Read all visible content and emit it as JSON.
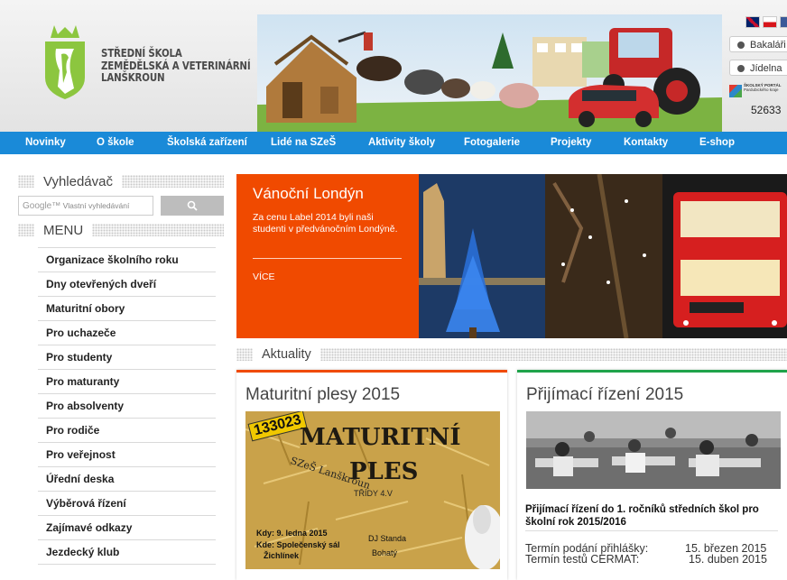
{
  "header": {
    "school_name_line1": "STŘEDNÍ ŠKOLA",
    "school_name_line2": "ZEMĚDĚLSKÁ A VETERINÁRNÍ",
    "school_name_line3": "LANŠKROUN",
    "link_bakalari": "Bakaláři",
    "link_jidelna": "Jídelna",
    "portal_line1": "ŠKOLSKÝ PORTÁL",
    "portal_line2": "Pardubického kraje",
    "visit_counter": "52633"
  },
  "nav": {
    "items": [
      "Novinky",
      "O škole",
      "Školská zařízení",
      "Lidé na SZeŠ",
      "Aktivity školy",
      "Fotogalerie",
      "Projekty",
      "Kontakty",
      "E-shop"
    ]
  },
  "sidebar": {
    "search_heading": "Vyhledávač",
    "search_placeholder_brand": "Google™",
    "search_placeholder": "Vlastní vyhledávání",
    "menu_heading": "MENU",
    "menu_items": [
      "Organizace školního roku",
      "Dny otevřených dveří",
      "Maturitní obory",
      "Pro uchazeče",
      "Pro studenty",
      "Pro maturanty",
      "Pro absolventy",
      "Pro rodiče",
      "Pro veřejnost",
      "Úřední deska",
      "Výběrová řízení",
      "Zajímavé odkazy",
      "Jezdecký klub"
    ]
  },
  "featured": {
    "title": "Vánoční Londýn",
    "text": "Za cenu Label 2014 byli naši studenti v předvánočním Londýně.",
    "more": "VÍCE"
  },
  "aktuality": {
    "heading": "Aktuality"
  },
  "card_left": {
    "title": "Maturitní plesy 2015",
    "poster_number": "133023",
    "poster_line1": "MATURITNÍ",
    "poster_line2": "PLES",
    "poster_school": "SZeŠ Lanškroun",
    "poster_class": "TŘÍDY 4.V",
    "poster_when": "Kdy: 9. ledna 2015",
    "poster_where": "Kde: Společenský sál",
    "poster_where2": "Žichlínek",
    "poster_dj": "DJ Standa",
    "poster_extra": "Bohatý"
  },
  "card_right": {
    "title": "Přijímací řízení 2015",
    "news_title": "Přijímací řízení do 1. ročníků středních škol pro školní rok 2015/2016",
    "row1_label": "Termín podání přihlášky:",
    "row1_value": "15. březen 2015",
    "row2_label": "Termín testů CERMAT:",
    "row2_value": "15. duben 2015"
  },
  "colors": {
    "nav_blue": "#1a8ad8",
    "orange": "#f04a00",
    "green": "#1fa34a",
    "logo_green": "#8cc63f"
  }
}
